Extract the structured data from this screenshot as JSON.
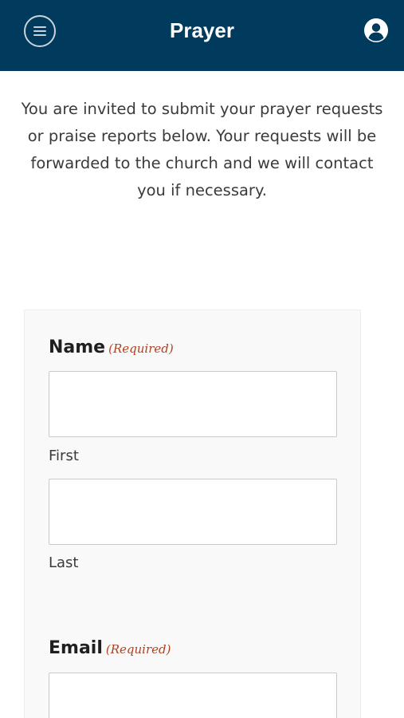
{
  "header": {
    "title": "Prayer",
    "menu_icon": "menu-icon",
    "account_icon": "account-circle-icon",
    "background_color": "#003a5d"
  },
  "intro": {
    "text": "You are invited to submit your prayer requests or praise reports below. Your requests will be forwarded to the church and we will contact you if necessary."
  },
  "form": {
    "name": {
      "label": "Name",
      "required_text": "(Required)",
      "first_sublabel": "First",
      "last_sublabel": "Last",
      "first_value": "",
      "last_value": ""
    },
    "email": {
      "label": "Email",
      "required_text": "(Required)",
      "value": ""
    },
    "required_color": "#b3401f"
  }
}
